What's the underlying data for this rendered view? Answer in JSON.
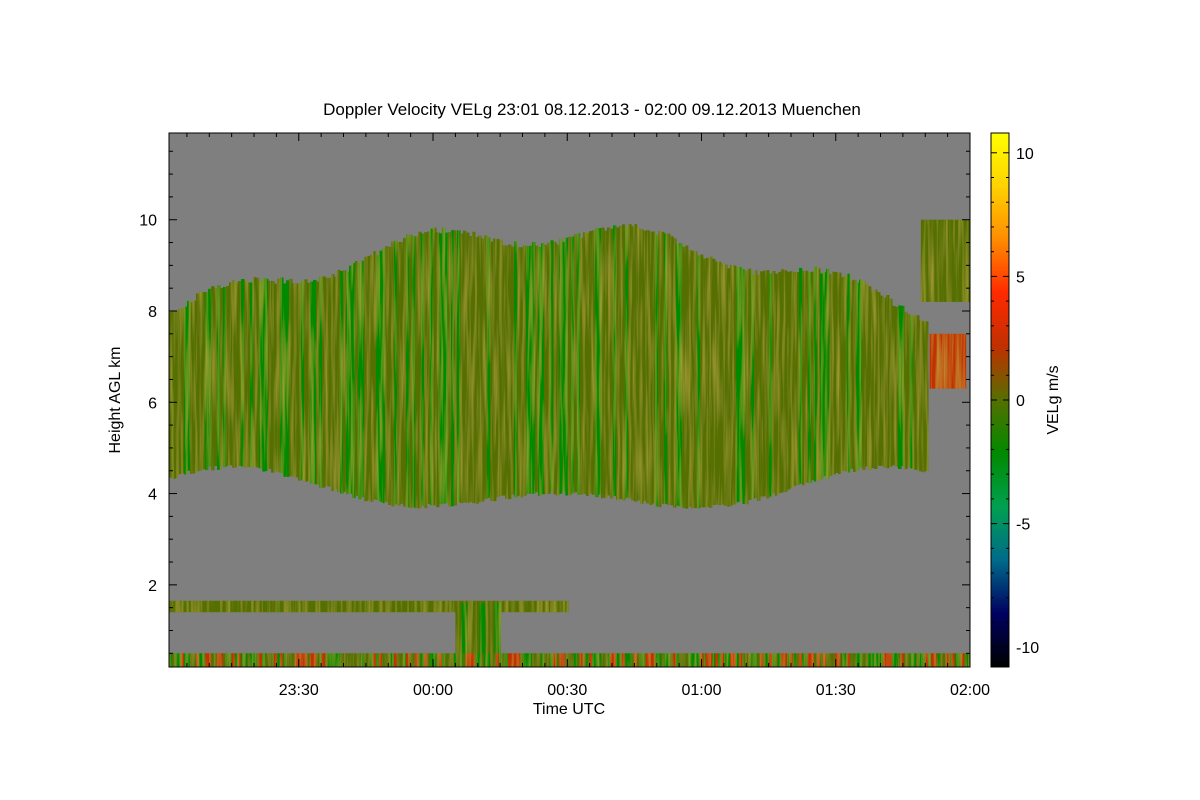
{
  "chart_data": {
    "type": "heatmap",
    "title": "Doppler Velocity VELg   23:01 08.12.2013 - 02:00 09.12.2013 Muenchen",
    "xlabel": "Time UTC",
    "ylabel": "Height AGL km",
    "xlim": [
      "23:01",
      "02:00"
    ],
    "ylim": [
      0.2,
      11.9
    ],
    "x_ticks": [
      "23:30",
      "00:00",
      "00:30",
      "01:00",
      "01:30",
      "02:00"
    ],
    "y_ticks": [
      2,
      4,
      6,
      8,
      10
    ],
    "colorbar": {
      "label": "VELg m/s",
      "range": [
        -10.8,
        10.8
      ],
      "ticks": [
        10,
        5,
        0,
        -5,
        -10
      ],
      "colors": [
        "#000000",
        "#000060",
        "#006a8a",
        "#00a050",
        "#008a00",
        "#556f00",
        "#c03000",
        "#ff2a00",
        "#ff8c00",
        "#ffd200",
        "#ffff00"
      ]
    },
    "background_color": "#7f7f7f",
    "features": [
      {
        "name": "main cloud layer",
        "x_start": "23:01",
        "x_end": "01:50",
        "base_km": [
          3.4,
          4.6
        ],
        "top_km": [
          7.0,
          9.7
        ],
        "velocity_ms": [
          -2,
          1
        ]
      },
      {
        "name": "upper cloud patch",
        "x_start": "01:49",
        "x_end": "02:00",
        "base_km": 8.2,
        "top_km": 10.0,
        "velocity_ms": [
          0,
          1
        ]
      },
      {
        "name": "warm patch",
        "x_start": "01:51",
        "x_end": "01:59",
        "base_km": 6.3,
        "top_km": 7.5,
        "velocity_ms": [
          2,
          3
        ]
      },
      {
        "name": "low layer",
        "x_start": "23:01",
        "x_end": "00:30",
        "base_km": 1.4,
        "top_km": 1.65,
        "velocity_ms": [
          -1,
          1
        ]
      },
      {
        "name": "precipitation streak",
        "x_start": "00:05",
        "x_end": "00:15",
        "base_km": 0.2,
        "top_km": 1.6,
        "velocity_ms": [
          -2,
          0
        ]
      },
      {
        "name": "ground clutter",
        "x_start": "23:01",
        "x_end": "02:00",
        "base_km": 0.2,
        "top_km": 0.5,
        "velocity_ms": [
          -3,
          3
        ]
      }
    ]
  }
}
